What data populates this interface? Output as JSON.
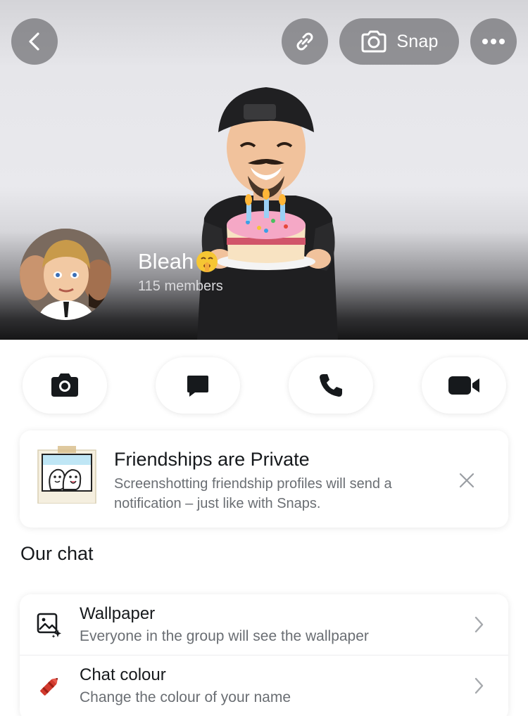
{
  "header": {
    "snap_label": "Snap",
    "group_name": "Bleah",
    "group_emoji": "shushing-face",
    "members": "115 members"
  },
  "actions": [
    {
      "icon": "camera-icon"
    },
    {
      "icon": "chat-icon"
    },
    {
      "icon": "phone-icon"
    },
    {
      "icon": "video-icon"
    }
  ],
  "privacy_card": {
    "title": "Friendships are Private",
    "description": "Screenshotting friendship profiles will send a notification – just like with Snaps."
  },
  "section": {
    "title": "Our chat"
  },
  "settings": {
    "wallpaper": {
      "title": "Wallpaper",
      "subtitle": "Everyone in the group will see the wallpaper"
    },
    "chat_colour": {
      "title": "Chat colour",
      "subtitle": "Change the colour of your name"
    }
  },
  "colors": {
    "header_button_bg": "#78787c",
    "text_primary": "#16191c",
    "text_secondary": "#6a6e73",
    "crayon_red": "#d23a2e"
  }
}
